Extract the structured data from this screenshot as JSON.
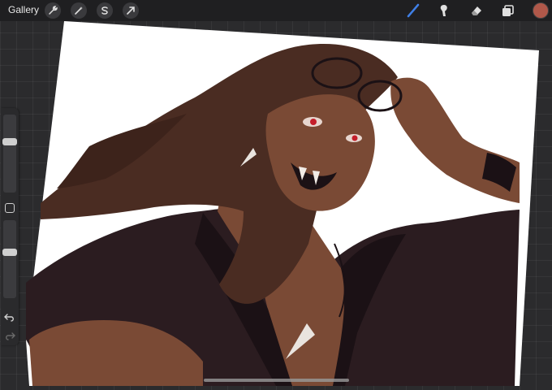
{
  "toolbar": {
    "gallery_label": "Gallery",
    "left_tools": [
      "wrench-icon",
      "magic-wand-icon",
      "selection-s-icon",
      "transform-arrow-icon"
    ],
    "right_tools": [
      "brush-icon",
      "smudge-icon",
      "eraser-icon",
      "layers-icon"
    ],
    "active_tool": "brush-icon",
    "active_color": "#b0584a"
  },
  "colors": {
    "accent": "#3f7fe6",
    "interface_bg": "#1f1f21",
    "canvas_bg": "#ffffff",
    "shirt": "#2b1c20",
    "skin": "#7a4a35",
    "hair": "#4a2c22"
  },
  "sidebar": {
    "brush_size_level": 0.33,
    "opacity_level": 0.4,
    "undo_icon": "undo-arrow-icon",
    "redo_icon": "redo-arrow-icon"
  }
}
